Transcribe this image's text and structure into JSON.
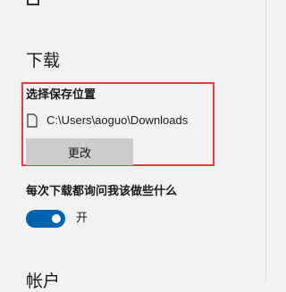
{
  "download": {
    "section_title": "下载",
    "choose_location_label": "选择保存位置",
    "download_path": "C:\\Users\\aoguo\\Downloads",
    "change_button_label": "更改",
    "ask_each_download_label": "每次下载都询问我该做些什么",
    "ask_toggle_state": "开",
    "ask_toggle_on": true
  },
  "next_section": {
    "title": "帐户"
  },
  "icons": {
    "path_icon": "file-icon",
    "top_partial": "checkbox-icon"
  },
  "colors": {
    "background": "#f2f2f2",
    "highlight_border": "#e03c3c",
    "toggle_on": "#0063b1",
    "button_bg": "#cccccc"
  }
}
